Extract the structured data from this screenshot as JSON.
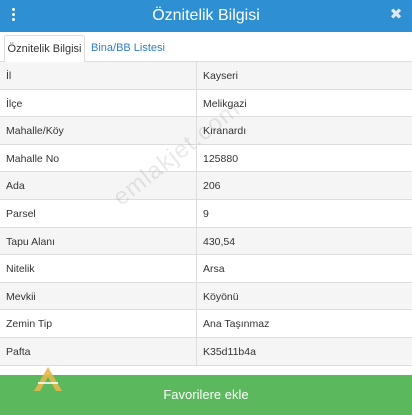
{
  "header": {
    "title": "Öznitelik Bilgisi",
    "close_icon_glyph": "✖",
    "color": "#2f8fd3"
  },
  "tabs": [
    {
      "label": "Öznitelik Bilgisi",
      "active": true
    },
    {
      "label": "Bina/BB Listesi",
      "active": false
    }
  ],
  "rows": [
    {
      "key": "İl",
      "value": "Kayseri"
    },
    {
      "key": "İlçe",
      "value": "Melikgazi"
    },
    {
      "key": "Mahalle/Köy",
      "value": "Kıranardı"
    },
    {
      "key": "Mahalle No",
      "value": "125880"
    },
    {
      "key": "Ada",
      "value": "206"
    },
    {
      "key": "Parsel",
      "value": "9"
    },
    {
      "key": "Tapu Alanı",
      "value": "430,54"
    },
    {
      "key": "Nitelik",
      "value": "Arsa"
    },
    {
      "key": "Mevkii",
      "value": "Köyönü"
    },
    {
      "key": "Zemin Tip",
      "value": "Ana Taşınmaz"
    },
    {
      "key": "Pafta",
      "value": "K35d11b4a"
    }
  ],
  "watermark": "emlakjet.com",
  "footer": {
    "button_label": "Favorilere ekle",
    "color": "#5bb85d"
  },
  "icons": {
    "menu": "kebab-menu-icon",
    "close": "close-icon",
    "logo": "agency-logo"
  }
}
